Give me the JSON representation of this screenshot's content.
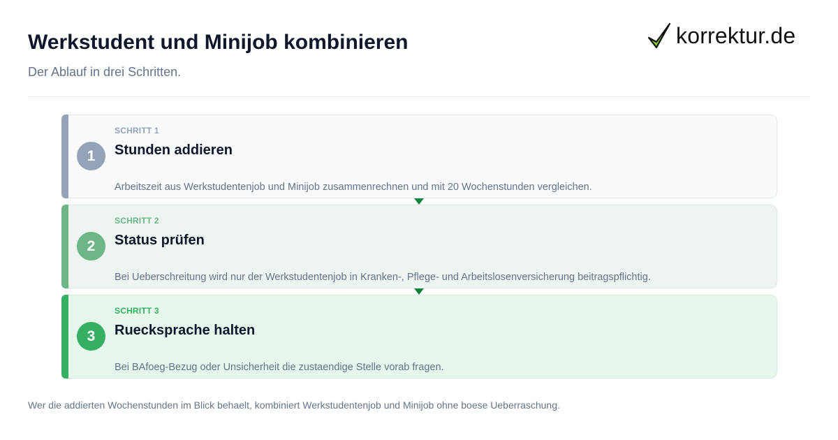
{
  "header": {
    "title": "Werkstudent und Minijob kombinieren",
    "subtitle": "Der Ablauf in drei Schritten."
  },
  "logo": {
    "text": "korrektur.de",
    "icon": "checkmark-icon",
    "check_color": "#84cc16"
  },
  "steps": [
    {
      "number": "1",
      "label": "SCHRITT 1",
      "title": "Stunden addieren",
      "description": "Arbeitszeit aus Werkstudentenjob und Minijob zusammenrechnen und mit 20 Wochenstunden vergleichen.",
      "color": "#94a3b8"
    },
    {
      "number": "2",
      "label": "SCHRITT 2",
      "title": "Status prüfen",
      "description": "Bei Ueberschreitung wird nur der Werkstudentenjob in Kranken-, Pflege- und Arbeitslosenversicherung beitragspflichtig.",
      "color": "#6cb688"
    },
    {
      "number": "3",
      "label": "SCHRITT 3",
      "title": "Ruecksprache halten",
      "description": "Bei BAfoeg-Bezug oder Unsicherheit die zustaendige Stelle vorab fragen.",
      "color": "#35b062"
    }
  ],
  "connector_color": "#15803d",
  "footer": {
    "text": "Wer die addierten Wochenstunden im Blick behaelt, kombiniert Werkstudentenjob und Minijob ohne boese Ueberraschung."
  }
}
